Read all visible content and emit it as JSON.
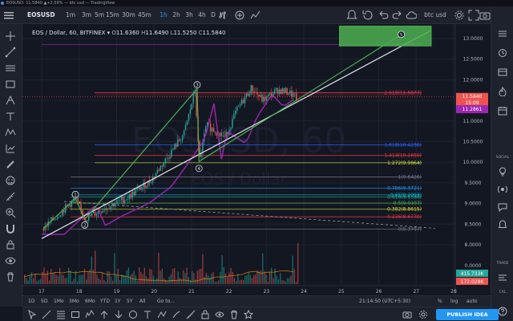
{
  "window": {
    "title": "EOSUSD: 11.5840 ▲+2.59% — btc usd — TradingView"
  },
  "toolbar": {
    "symbol": "EOSUSD",
    "intervals": [
      "1m",
      "3m",
      "5m",
      "15m",
      "30m",
      "45m",
      "1h",
      "2h",
      "3h",
      "4h",
      "D",
      "W"
    ],
    "active_interval": "1h",
    "layout_name": "btc usd"
  },
  "legend": {
    "title": "EOS / Dollar, 60, BITFINEX",
    "open_label": "O",
    "open": "11.6360",
    "high_label": "H",
    "high": "11.6490",
    "low_label": "L",
    "low": "11.5250",
    "close_label": "C",
    "close": "11.5840"
  },
  "watermark": {
    "line1": "EOSUSD, 60",
    "line2": "EOS / Dollar"
  },
  "price_axis": {
    "ticks": [
      "13.0000",
      "12.5000",
      "12.0000",
      "11.5000",
      "11.0000",
      "10.5000",
      "10.0000",
      "9.5000",
      "9.0000",
      "8.5000",
      "8.0000"
    ],
    "current_price": "11.5840",
    "countdown": "15:09",
    "ma_price": "11.2861",
    "vol1": "415.733K",
    "vol2": "172.028K",
    "zero": "0.0000"
  },
  "time_axis": {
    "ticks": [
      "17",
      "18",
      "19",
      "20",
      "21",
      "22",
      "23",
      "24",
      "25",
      "26",
      "27",
      "28"
    ]
  },
  "fib_levels": [
    {
      "label": "3.618(12.8517)",
      "color": "#9c27b0"
    },
    {
      "label": "2.618(11.6877)",
      "color": "#f23645"
    },
    {
      "label": "1.618(10.4236)",
      "color": "#2962ff"
    },
    {
      "label": "1.414(10.1659)",
      "color": "#f23645"
    },
    {
      "label": "1.272(9.9864)",
      "color": "#cddc39"
    },
    {
      "label": "1(9.6426)",
      "color": "#787b86"
    },
    {
      "label": "0.786(9.3721)",
      "color": "#2196f3"
    },
    {
      "label": "0.618(9.1598)",
      "color": "#26a69a"
    },
    {
      "label": "0.5(9.0107)",
      "color": "#4caf50"
    },
    {
      "label": "0.382(8.8615)",
      "color": "#cddc39"
    },
    {
      "label": "0.236(8.6770)",
      "color": "#f23645"
    },
    {
      "label": "0(8.3787)",
      "color": "#787b86"
    },
    {
      "label": "0.65(9.2093)",
      "color": "#00bcd4"
    }
  ],
  "wave_labels": [
    "①",
    "②",
    "③",
    "④",
    "⑤"
  ],
  "bottom_bar": {
    "ranges": [
      "1D",
      "5D",
      "1Mo",
      "3Mo",
      "6Mo",
      "YTD",
      "1Y",
      "5Y",
      "All"
    ],
    "goto": "Go to...",
    "clock": "21:14:50 (UTC+5:30)",
    "toggles": [
      "%",
      "log",
      "auto"
    ]
  },
  "right_panel": {
    "social_label": "SOCIAL",
    "cal_label": "CAL",
    "trade_label": "TRADE"
  },
  "publish_label": "PUBLISH IDEA",
  "colors": {
    "background": "#131722",
    "panel": "#1e222d",
    "accent": "#2196f3",
    "up": "#26a69a",
    "down": "#ef5350",
    "ma_line": "#9c27b0",
    "pattern": "#4caf50"
  }
}
